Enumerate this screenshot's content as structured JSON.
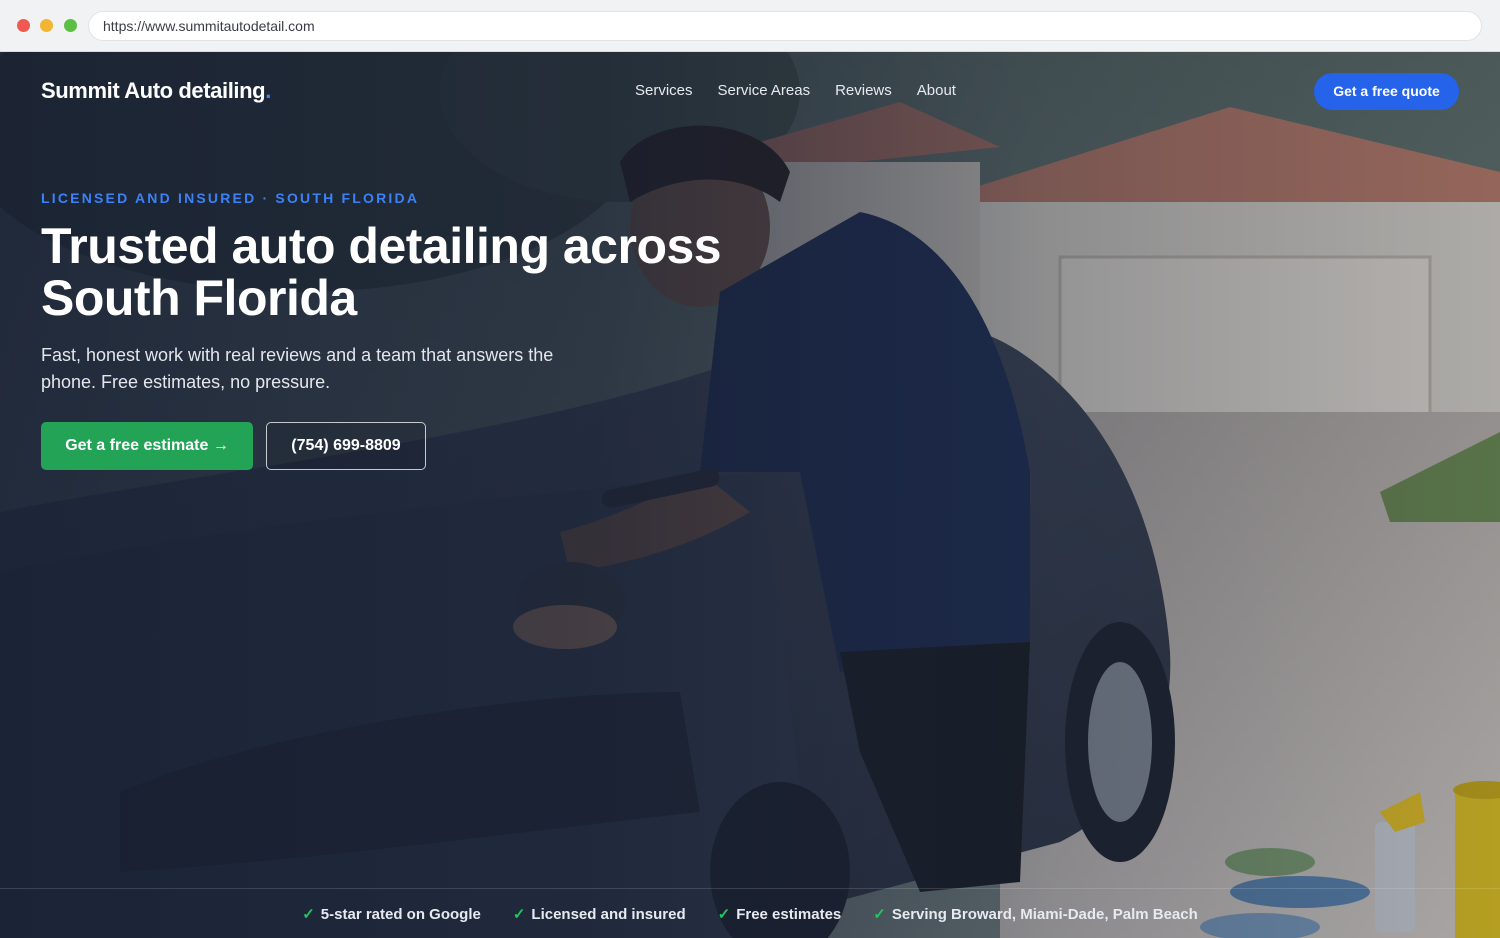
{
  "browser": {
    "url": "https://www.summitautodetail.com"
  },
  "header": {
    "brand": "Summit Auto detailing",
    "brand_dot": ".",
    "nav": [
      "Services",
      "Service Areas",
      "Reviews",
      "About"
    ],
    "cta": "Get a free quote"
  },
  "hero": {
    "eyebrow": "LICENSED AND INSURED · SOUTH FLORIDA",
    "headline": "Trusted auto detailing across South Florida",
    "subcopy": "Fast, honest work with real reviews and a team that answers the phone. Free estimates, no pressure.",
    "primary_cta": "Get a free estimate →",
    "secondary_cta": "(754) 699-8809"
  },
  "trust": [
    "5-star rated on Google",
    "Licensed and insured",
    "Free estimates",
    "Serving Broward, Miami-Dade, Palm Beach"
  ],
  "icons": {
    "check": "✓"
  },
  "colors": {
    "accent_blue": "#2563eb",
    "eyebrow_blue": "#3b82f6",
    "cta_green": "#22a356",
    "check_green": "#22c55e"
  }
}
